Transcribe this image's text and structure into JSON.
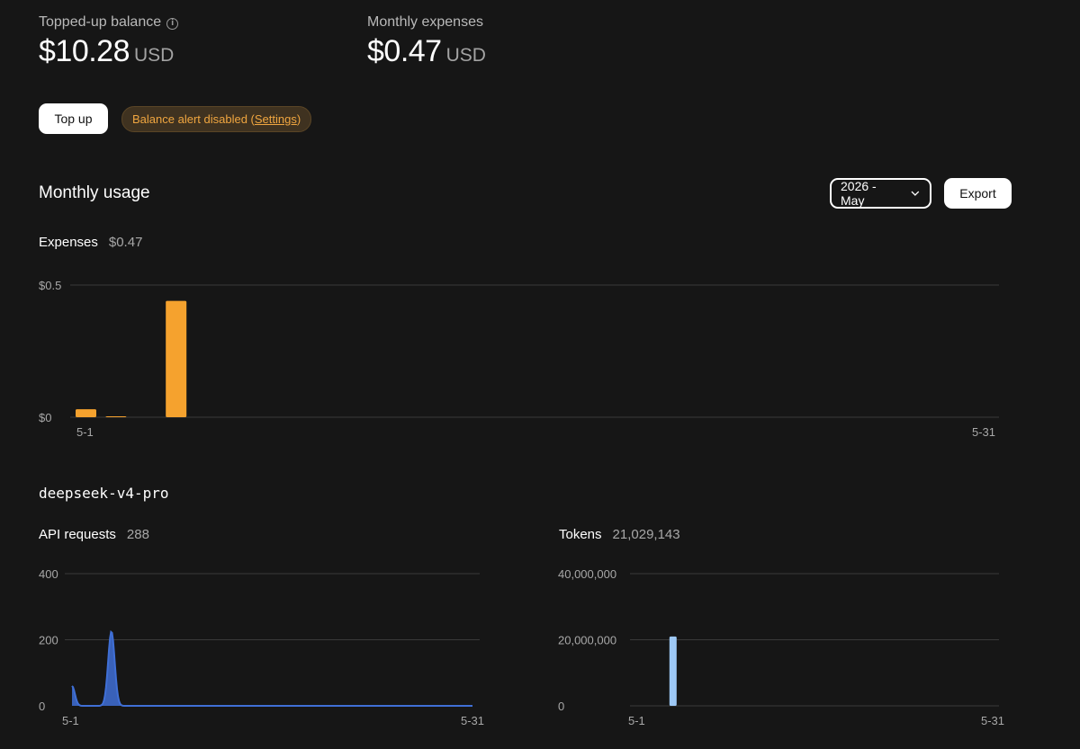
{
  "balance": {
    "label": "Topped-up balance",
    "amount": "$10.28",
    "unit": "USD"
  },
  "expenses_summary": {
    "label": "Monthly expenses",
    "amount": "$0.47",
    "unit": "USD"
  },
  "actions": {
    "top_up": "Top up"
  },
  "alert": {
    "text": "Balance alert disabled (",
    "link": "Settings",
    "suffix": ")"
  },
  "usage": {
    "title": "Monthly usage",
    "month_select": "2026 - May",
    "export": "Export"
  },
  "expenses": {
    "label": "Expenses",
    "value": "$0.47"
  },
  "model": {
    "name": "deepseek-v4-pro"
  },
  "api_requests": {
    "label": "API requests",
    "value": "288"
  },
  "tokens": {
    "label": "Tokens",
    "value": "21,029,143"
  },
  "colors": {
    "expense_bar": "#f5a22e",
    "requests_area": "#3f6fd6",
    "tokens_bar": "#9dc8f5"
  },
  "chart_data": [
    {
      "type": "bar",
      "title": "Expenses",
      "x": [
        "5-1",
        "5-2",
        "5-3",
        "5-4",
        "5-5",
        "5-6",
        "5-7",
        "5-8",
        "5-9",
        "5-10",
        "5-11",
        "5-12",
        "5-13",
        "5-14",
        "5-15",
        "5-16",
        "5-17",
        "5-18",
        "5-19",
        "5-20",
        "5-21",
        "5-22",
        "5-23",
        "5-24",
        "5-25",
        "5-26",
        "5-27",
        "5-28",
        "5-29",
        "5-30",
        "5-31"
      ],
      "values": [
        0.03,
        0.002,
        0,
        0.44,
        0,
        0,
        0,
        0,
        0,
        0,
        0,
        0,
        0,
        0,
        0,
        0,
        0,
        0,
        0,
        0,
        0,
        0,
        0,
        0,
        0,
        0,
        0,
        0,
        0,
        0,
        0
      ],
      "ylim": [
        0,
        0.5
      ],
      "yticks": [
        "$0",
        "$0.5"
      ],
      "xticks": [
        "5-1",
        "5-31"
      ],
      "grid": true
    },
    {
      "type": "area",
      "title": "API requests",
      "x": [
        "5-1",
        "5-2",
        "5-3",
        "5-4",
        "5-5",
        "5-6",
        "5-7",
        "5-8",
        "5-9",
        "5-10",
        "5-11",
        "5-12",
        "5-13",
        "5-14",
        "5-15",
        "5-16",
        "5-17",
        "5-18",
        "5-19",
        "5-20",
        "5-21",
        "5-22",
        "5-23",
        "5-24",
        "5-25",
        "5-26",
        "5-27",
        "5-28",
        "5-29",
        "5-30",
        "5-31"
      ],
      "values": [
        60,
        0,
        0,
        225,
        0,
        0,
        0,
        0,
        0,
        0,
        0,
        0,
        0,
        0,
        0,
        0,
        0,
        0,
        0,
        0,
        0,
        0,
        0,
        0,
        0,
        0,
        0,
        0,
        0,
        0,
        0
      ],
      "ylim": [
        0,
        400
      ],
      "yticks": [
        "0",
        "200",
        "400"
      ],
      "xticks": [
        "5-1",
        "5-31"
      ],
      "grid": true
    },
    {
      "type": "bar",
      "title": "Tokens",
      "x": [
        "5-1",
        "5-2",
        "5-3",
        "5-4",
        "5-5",
        "5-6",
        "5-7",
        "5-8",
        "5-9",
        "5-10",
        "5-11",
        "5-12",
        "5-13",
        "5-14",
        "5-15",
        "5-16",
        "5-17",
        "5-18",
        "5-19",
        "5-20",
        "5-21",
        "5-22",
        "5-23",
        "5-24",
        "5-25",
        "5-26",
        "5-27",
        "5-28",
        "5-29",
        "5-30",
        "5-31"
      ],
      "values": [
        0,
        0,
        0,
        21000000,
        0,
        0,
        0,
        0,
        0,
        0,
        0,
        0,
        0,
        0,
        0,
        0,
        0,
        0,
        0,
        0,
        0,
        0,
        0,
        0,
        0,
        0,
        0,
        0,
        0,
        0,
        0
      ],
      "ylim": [
        0,
        40000000
      ],
      "yticks": [
        "0",
        "20,000,000",
        "40,000,000"
      ],
      "xticks": [
        "5-1",
        "5-31"
      ],
      "grid": true
    }
  ]
}
